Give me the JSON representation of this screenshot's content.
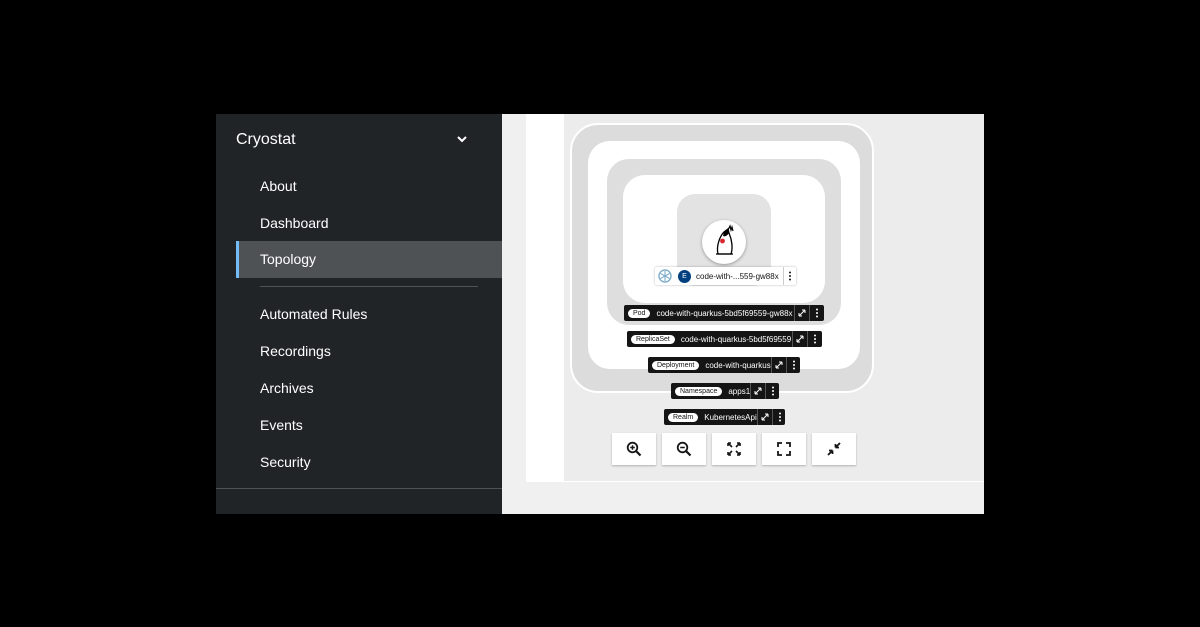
{
  "app": {
    "title": "Cryostat"
  },
  "nav": {
    "items": [
      {
        "label": "About"
      },
      {
        "label": "Dashboard"
      },
      {
        "label": "Topology",
        "active": true
      },
      {
        "label": "Automated Rules"
      },
      {
        "label": "Recordings"
      },
      {
        "label": "Archives"
      },
      {
        "label": "Events"
      },
      {
        "label": "Security"
      }
    ]
  },
  "topology": {
    "target": {
      "badge": "E",
      "name": "code-with-...559-gw88x"
    },
    "groups": [
      {
        "badge": "Pod",
        "name": "code-with-quarkus-5bd5f69559-gw88x"
      },
      {
        "badge": "ReplicaSet",
        "name": "code-with-quarkus-5bd5f69559"
      },
      {
        "badge": "Deployment",
        "name": "code-with-quarkus"
      },
      {
        "badge": "Namespace",
        "name": "apps1"
      },
      {
        "badge": "Realm",
        "name": "KubernetesApi"
      }
    ]
  },
  "controls": [
    "zoom-in-icon",
    "zoom-out-icon",
    "fit-to-screen-icon",
    "fullscreen-icon",
    "collapse-icon"
  ],
  "colors": {
    "sidebar": "#212427",
    "active_item": "#4f5255",
    "active_accent": "#73bcf7",
    "badge_blue": "#004080"
  }
}
